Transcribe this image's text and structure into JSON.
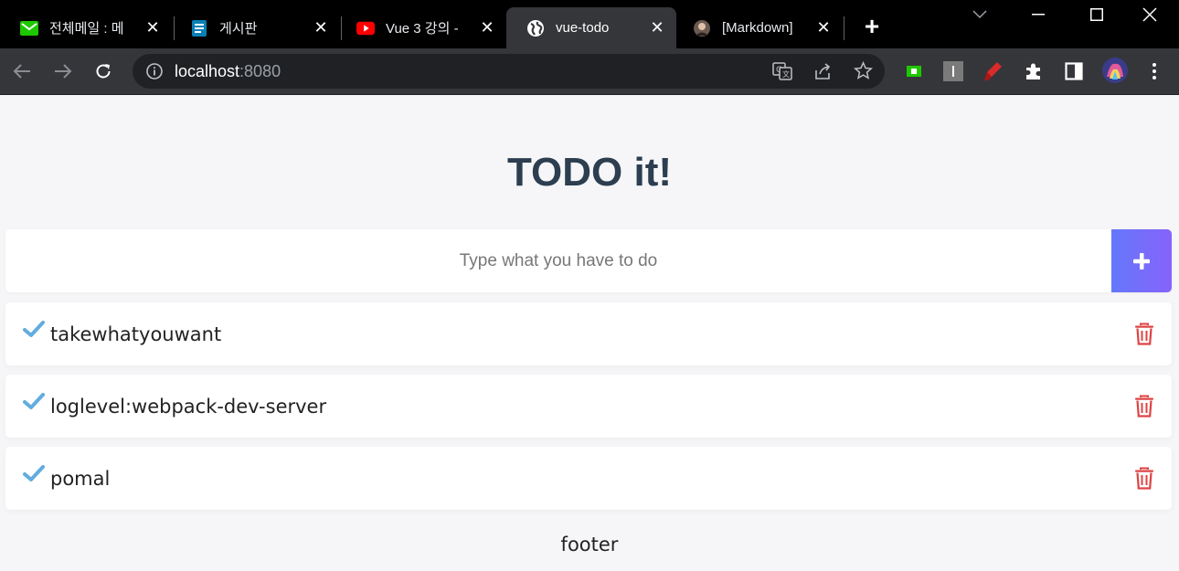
{
  "browser": {
    "tabs": [
      {
        "title": "전체메일 : 메",
        "icon": "mail-icon",
        "active": false
      },
      {
        "title": "게시판",
        "icon": "board-icon",
        "active": false
      },
      {
        "title": "Vue 3 강의 -",
        "icon": "youtube-icon",
        "active": false
      },
      {
        "title": "vue-todo",
        "icon": "globe-icon",
        "active": true
      },
      {
        "title": "[Markdown]",
        "icon": "avatar-icon",
        "active": false
      }
    ],
    "new_tab": "+",
    "url_host": "localhost",
    "url_port": ":8080"
  },
  "app": {
    "title": "TODO it!",
    "input_placeholder": "Type what you have to do",
    "todos": [
      {
        "text": "takewhatyouwant",
        "completed": true
      },
      {
        "text": "loglevel:webpack-dev-server",
        "completed": true
      },
      {
        "text": "pomal",
        "completed": true
      }
    ],
    "footer": "footer"
  },
  "colors": {
    "accent_start": "#6478fb",
    "accent_end": "#8763fb",
    "check": "#62acde",
    "trash": "#de4343",
    "title": "#2c3e50"
  }
}
